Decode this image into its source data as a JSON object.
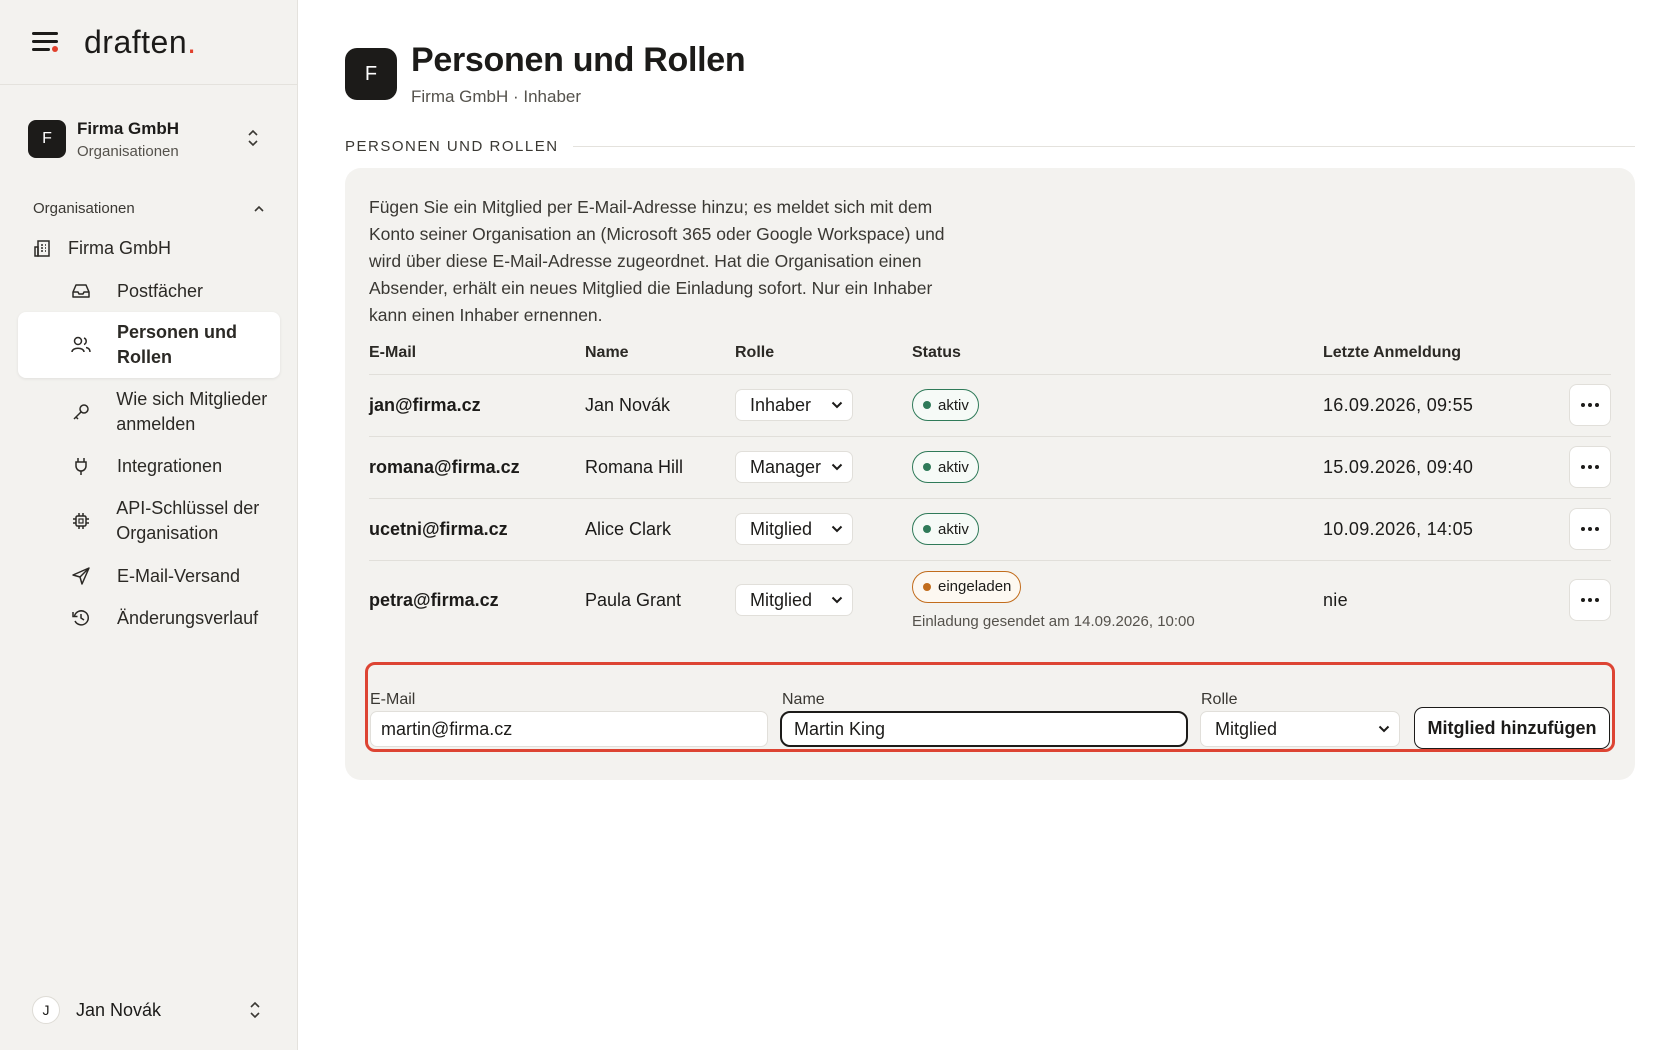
{
  "app": {
    "brand": "draften"
  },
  "org_switch": {
    "initial": "F",
    "name": "Firma GmbH",
    "subtitle": "Organisationen"
  },
  "sidebar": {
    "section_label": "Organisationen",
    "org_item": "Firma GmbH",
    "items": [
      {
        "label": "Postfächer",
        "icon": "inbox-icon"
      },
      {
        "label": "Personen und Rollen",
        "icon": "users-icon",
        "active": true
      },
      {
        "label": "Wie sich Mitglieder anmelden",
        "icon": "key-icon"
      },
      {
        "label": "Integrationen",
        "icon": "plug-icon"
      },
      {
        "label": "API-Schlüssel der Organisation",
        "icon": "chip-icon"
      },
      {
        "label": "E-Mail-Versand",
        "icon": "send-icon"
      },
      {
        "label": "Änderungsverlauf",
        "icon": "history-icon"
      }
    ]
  },
  "user": {
    "initial": "J",
    "name": "Jan Novák"
  },
  "page": {
    "avatar_initial": "F",
    "title": "Personen und Rollen",
    "subtitle": "Firma GmbH · Inhaber",
    "section_label": "PERSONEN UND ROLLEN",
    "intro": "Fügen Sie ein Mitglied per E-Mail-Adresse hinzu; es meldet sich mit dem Konto seiner Organisation an (Microsoft 365 oder Google Workspace) und wird über diese E-Mail-Adresse zugeordnet. Hat die Organisation einen Absender, erhält ein neues Mitglied die Einladung sofort. Nur ein Inhaber kann einen Inhaber ernennen."
  },
  "table": {
    "headers": {
      "email": "E-Mail",
      "name": "Name",
      "role": "Rolle",
      "status": "Status",
      "last_login": "Letzte Anmeldung"
    },
    "rows": [
      {
        "email": "jan@firma.cz",
        "name": "Jan Novák",
        "role": "Inhaber",
        "status": "aktiv",
        "last_login": "16.09.2026, 09:55"
      },
      {
        "email": "romana@firma.cz",
        "name": "Romana Hill",
        "role": "Manager",
        "status": "aktiv",
        "last_login": "15.09.2026, 09:40"
      },
      {
        "email": "ucetni@firma.cz",
        "name": "Alice Clark",
        "role": "Mitglied",
        "status": "aktiv",
        "last_login": "10.09.2026, 14:05"
      },
      {
        "email": "petra@firma.cz",
        "name": "Paula Grant",
        "role": "Mitglied",
        "status": "eingeladen",
        "status_note": "Einladung gesendet am 14.09.2026, 10:00",
        "last_login": "nie"
      }
    ]
  },
  "add_form": {
    "email_label": "E-Mail",
    "email_value": "martin@firma.cz",
    "name_label": "Name",
    "name_value": "Martin King",
    "role_label": "Rolle",
    "role_value": "Mitglied",
    "submit_label": "Mitglied hinzufügen"
  },
  "colors": {
    "accent": "#e1402c",
    "active_status": "#2f7a59",
    "invited_status": "#c26c1c",
    "highlight": "#dd4433"
  }
}
